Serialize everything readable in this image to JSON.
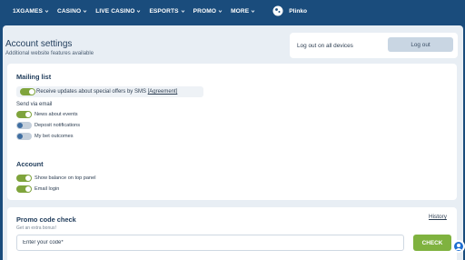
{
  "nav": {
    "items": [
      "1XGAMES",
      "CASINO",
      "LIVE CASINO",
      "ESPORTS",
      "PROMO",
      "MORE"
    ],
    "plinko": "Plinko"
  },
  "page": {
    "title": "Account settings",
    "subtitle": "Additional website features available"
  },
  "logout": {
    "all_devices": "Log out on all devices",
    "button": "Log out"
  },
  "mailing": {
    "title": "Mailing list",
    "sms_text": "Receive updates about special offers by SMS",
    "sms_agreement": "[Agreement]",
    "sms_enabled": true,
    "send_via_email": "Send via email",
    "options": [
      {
        "label": "News about events",
        "enabled": true
      },
      {
        "label": "Deposit notifications",
        "enabled": false
      },
      {
        "label": "My bet outcomes",
        "enabled": false
      }
    ]
  },
  "account": {
    "title": "Account",
    "options": [
      {
        "label": "Show balance on top panel",
        "enabled": true
      },
      {
        "label": "Email login",
        "enabled": true
      }
    ]
  },
  "promo": {
    "title": "Promo code check",
    "history": "History",
    "subtitle": "Get an extra bonus!",
    "placeholder": "Enter your code*",
    "check": "CHECK"
  },
  "colors": {
    "nav_bg": "#1a4c7c",
    "toggle_on": "#7fa43c",
    "check_button": "#7fb23f"
  }
}
